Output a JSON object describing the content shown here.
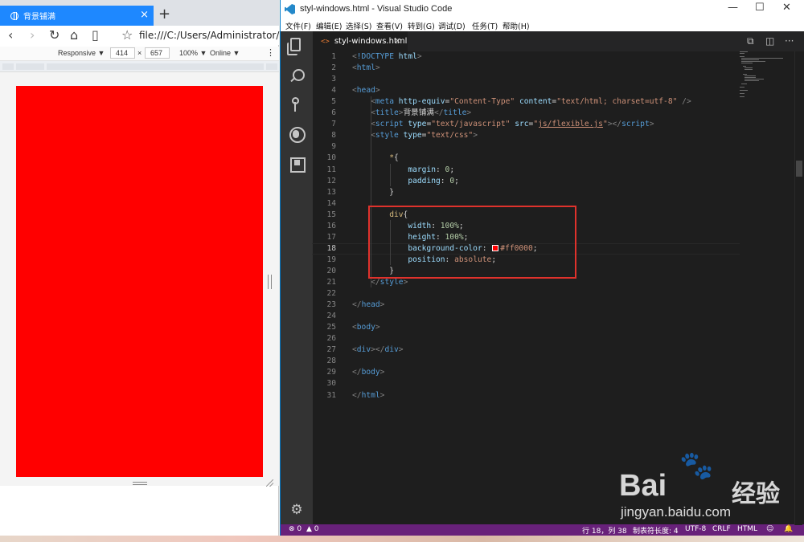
{
  "browser": {
    "tab_title": "背景铺满",
    "tab_close": "×",
    "new_tab": "+",
    "url": "file:///C:/Users/Administrator/Deskt",
    "devtools": {
      "mode": "Responsive ▼",
      "width": "414",
      "times": "×",
      "height": "657",
      "zoom": "100% ▼",
      "network": "Online ▼",
      "more": "⋮"
    },
    "page_div_color": "#ff0000"
  },
  "vscode": {
    "window_title": "styl-windows.html - Visual Studio Code",
    "window_controls": {
      "minimize": "—",
      "maximize": "☐",
      "close": "✕"
    },
    "menu": [
      "文件(F)",
      "编辑(E)",
      "选择(S)",
      "查看(V)",
      "转到(G)",
      "调试(D)",
      "任务(T)",
      "帮助(H)"
    ],
    "editor_tab": {
      "chevron": "<>",
      "label": "styl-windows.html",
      "close": "×"
    },
    "code_lines": [
      {
        "n": "1",
        "html": "<span class='t-punct'>&lt;</span><span class='t-tag'>!DOCTYPE</span> <span class='t-attr'>html</span><span class='t-punct'>&gt;</span>"
      },
      {
        "n": "2",
        "html": "<span class='t-punct'>&lt;</span><span class='t-tag'>html</span><span class='t-punct'>&gt;</span>"
      },
      {
        "n": "3",
        "html": ""
      },
      {
        "n": "4",
        "html": "<span class='t-punct'>&lt;</span><span class='t-tag'>head</span><span class='t-punct'>&gt;</span>"
      },
      {
        "n": "5",
        "html": "    <span class='t-punct'>&lt;</span><span class='t-tag'>meta</span> <span class='t-attr'>http-equiv</span>=<span class='t-str'>\"Content-Type\"</span> <span class='t-attr'>content</span>=<span class='t-str'>\"text/html; charset=utf-8\"</span> <span class='t-punct'>/&gt;</span>"
      },
      {
        "n": "6",
        "html": "    <span class='t-punct'>&lt;</span><span class='t-tag'>title</span><span class='t-punct'>&gt;</span>背景铺满<span class='t-punct'>&lt;/</span><span class='t-tag'>title</span><span class='t-punct'>&gt;</span>"
      },
      {
        "n": "7",
        "html": "    <span class='t-punct'>&lt;</span><span class='t-tag'>script</span> <span class='t-attr'>type</span>=<span class='t-str'>\"text/javascript\"</span> <span class='t-attr'>src</span>=<span class='t-str'>\"<span class='t-under'>js/flexible.js</span>\"</span><span class='t-punct'>&gt;&lt;/</span><span class='t-tag'>script</span><span class='t-punct'>&gt;</span>"
      },
      {
        "n": "8",
        "html": "    <span class='t-punct'>&lt;</span><span class='t-tag'>style</span> <span class='t-attr'>type</span>=<span class='t-str'>\"text/css\"</span><span class='t-punct'>&gt;</span>"
      },
      {
        "n": "9",
        "html": ""
      },
      {
        "n": "10",
        "html": "        <span class='t-sel'>*</span>{"
      },
      {
        "n": "11",
        "html": "            <span class='t-prop'>margin</span>: <span class='t-num'>0</span>;"
      },
      {
        "n": "12",
        "html": "            <span class='t-prop'>padding</span>: <span class='t-num'>0</span>;"
      },
      {
        "n": "13",
        "html": "        }"
      },
      {
        "n": "14",
        "html": ""
      },
      {
        "n": "15",
        "html": "        <span class='t-sel'>div</span>{"
      },
      {
        "n": "16",
        "html": "            <span class='t-prop'>width</span>: <span class='t-num'>100%</span>;"
      },
      {
        "n": "17",
        "html": "            <span class='t-prop'>height</span>: <span class='t-num'>100%</span>;"
      },
      {
        "n": "18",
        "html": "            <span class='t-prop'>background-color</span>: <span class='swatch'></span><span class='t-val'>#ff0000</span>;"
      },
      {
        "n": "19",
        "html": "            <span class='t-prop'>position</span>: <span class='t-val'>absolute</span>;"
      },
      {
        "n": "20",
        "html": "        }"
      },
      {
        "n": "21",
        "html": "    <span class='t-punct'>&lt;/</span><span class='t-tag'>style</span><span class='t-punct'>&gt;</span>"
      },
      {
        "n": "22",
        "html": ""
      },
      {
        "n": "23",
        "html": "<span class='t-punct'>&lt;/</span><span class='t-tag'>head</span><span class='t-punct'>&gt;</span>"
      },
      {
        "n": "24",
        "html": ""
      },
      {
        "n": "25",
        "html": "<span class='t-punct'>&lt;</span><span class='t-tag'>body</span><span class='t-punct'>&gt;</span>"
      },
      {
        "n": "26",
        "html": ""
      },
      {
        "n": "27",
        "html": "<span class='t-punct'>&lt;</span><span class='t-tag'>div</span><span class='t-punct'>&gt;&lt;/</span><span class='t-tag'>div</span><span class='t-punct'>&gt;</span>"
      },
      {
        "n": "28",
        "html": ""
      },
      {
        "n": "29",
        "html": "<span class='t-punct'>&lt;/</span><span class='t-tag'>body</span><span class='t-punct'>&gt;</span>"
      },
      {
        "n": "30",
        "html": ""
      },
      {
        "n": "31",
        "html": "<span class='t-punct'>&lt;/</span><span class='t-tag'>html</span><span class='t-punct'>&gt;</span>"
      }
    ],
    "active_line": "18",
    "status": {
      "errors": "⊗ 0",
      "warnings": "▲ 0",
      "position": "行 18，列 38",
      "tab_size": "制表符长度: 4",
      "encoding": "UTF-8",
      "eol": "CRLF",
      "language": "HTML",
      "feedback": "☺",
      "bell": "🔔"
    },
    "accent_color": "#68217a",
    "highlight_box_color": "#e0322c"
  },
  "watermark": {
    "brand": "Bai",
    "paw": "🐾",
    "product": "经验",
    "url": "jingyan.baidu.com"
  }
}
